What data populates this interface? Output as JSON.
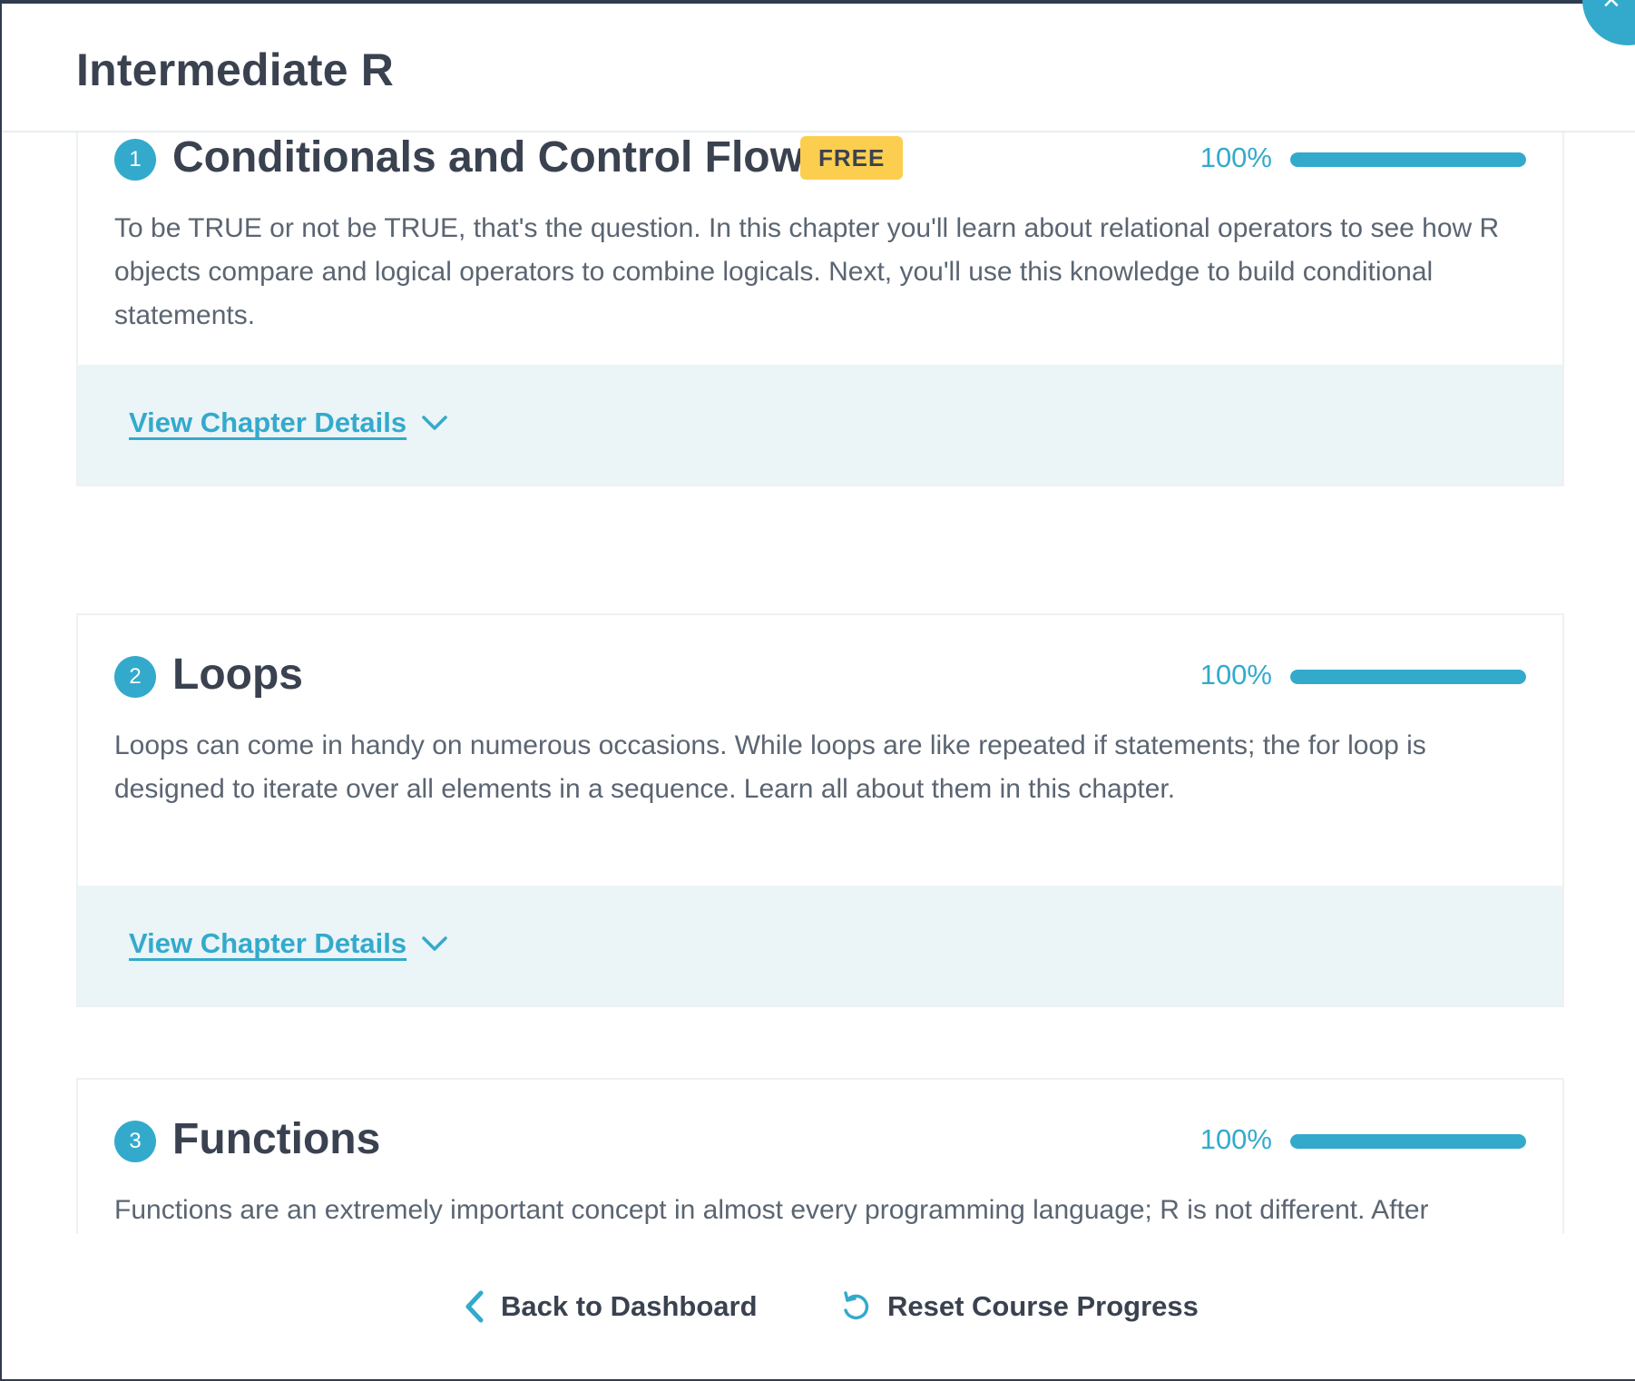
{
  "modal": {
    "title": "Intermediate R",
    "close_icon": "×"
  },
  "chapters": [
    {
      "number": "1",
      "title": "Conditionals and Control Flow",
      "badge": "FREE",
      "progress_label": "100%",
      "progress": 1.0,
      "description": "To be TRUE or not be TRUE, that's the question. In this chapter you'll learn about relational operators to see how R objects compare and logical operators to combine logicals. Next, you'll use this knowledge to build conditional statements.",
      "details_label": "View Chapter Details"
    },
    {
      "number": "2",
      "title": "Loops",
      "progress_label": "100%",
      "progress": 1.0,
      "description": "Loops can come in handy on numerous occasions. While loops are like repeated if statements; the for loop is designed to iterate over all elements in a sequence. Learn all about them in this chapter.",
      "details_label": "View Chapter Details"
    },
    {
      "number": "3",
      "title": "Functions",
      "progress_label": "100%",
      "progress": 1.0,
      "description": "Functions are an extremely important concept in almost every programming language; R is not different. After"
    }
  ],
  "footer": {
    "back_label": "Back to Dashboard",
    "reset_label": "Reset Course Progress"
  },
  "colors": {
    "accent": "#33aacc",
    "badge": "#fcce4f",
    "text": "#3a4250",
    "details_bg": "#ebf4f7"
  },
  "icons": {
    "close": "close-icon",
    "chevron": "chevron-down-icon",
    "back": "chevron-left-icon",
    "reset": "reset-icon"
  }
}
